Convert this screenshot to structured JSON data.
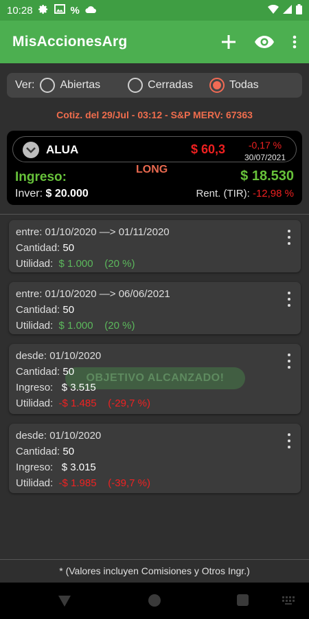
{
  "status": {
    "time": "10:28",
    "percent": "%"
  },
  "app": {
    "title": "MisAccionesArg"
  },
  "filter": {
    "label": "Ver:",
    "options": [
      "Abiertas",
      "Cerradas",
      "Todas"
    ],
    "selected": "Todas"
  },
  "quote_line": "Cotiz. del 29/Jul - 03:12  -  S&P MERV: 67363",
  "summary": {
    "ticker": "ALUA",
    "price": "$ 60,3",
    "variation": "-0,17 %",
    "date": "30/07/2021",
    "position": "LONG",
    "ingreso_label": "Ingreso:",
    "ingreso_value": "$ 18.530",
    "inver_label": "Inver:",
    "inver_value": "$ 20.000",
    "rent_label": "Rent. (TIR):",
    "rent_value": "-12,98 %"
  },
  "cards": [
    {
      "line1": "entre: 01/10/2020 —> 01/11/2020",
      "cantidad_label": "Cantidad:",
      "cantidad": "50",
      "utilidad_label": "Utilidad:",
      "utilidad": "$ 1.000",
      "utilidad_pct": "(20 %)"
    },
    {
      "line1": "entre: 01/10/2020 —> 06/06/2021",
      "cantidad_label": "Cantidad:",
      "cantidad": "50",
      "utilidad_label": "Utilidad:",
      "utilidad": "$ 1.000",
      "utilidad_pct": "(20 %)"
    },
    {
      "line1": "desde: 01/10/2020",
      "cantidad_label": "Cantidad:",
      "cantidad": "50",
      "ingreso_label": "Ingreso:",
      "ingreso": "$ 3.515",
      "utilidad_label": "Utilidad:",
      "utilidad": "-$ 1.485",
      "utilidad_pct": "(-29,7 %)",
      "watermark": "OBJETIVO ALCANZADO!"
    },
    {
      "line1": "desde: 01/10/2020",
      "cantidad_label": "Cantidad:",
      "cantidad": "50",
      "ingreso_label": "Ingreso:",
      "ingreso": "$ 3.015",
      "utilidad_label": "Utilidad:",
      "utilidad": "-$ 1.985",
      "utilidad_pct": "(-39,7 %)"
    }
  ],
  "footer": "* (Valores incluyen Comisiones y Otros Ingr.)",
  "colors": {
    "appbar": "#4caf50",
    "statusbar": "#3f9e43",
    "accent": "#f26b55",
    "positive": "#5cb85c",
    "negative": "#ee2222"
  }
}
